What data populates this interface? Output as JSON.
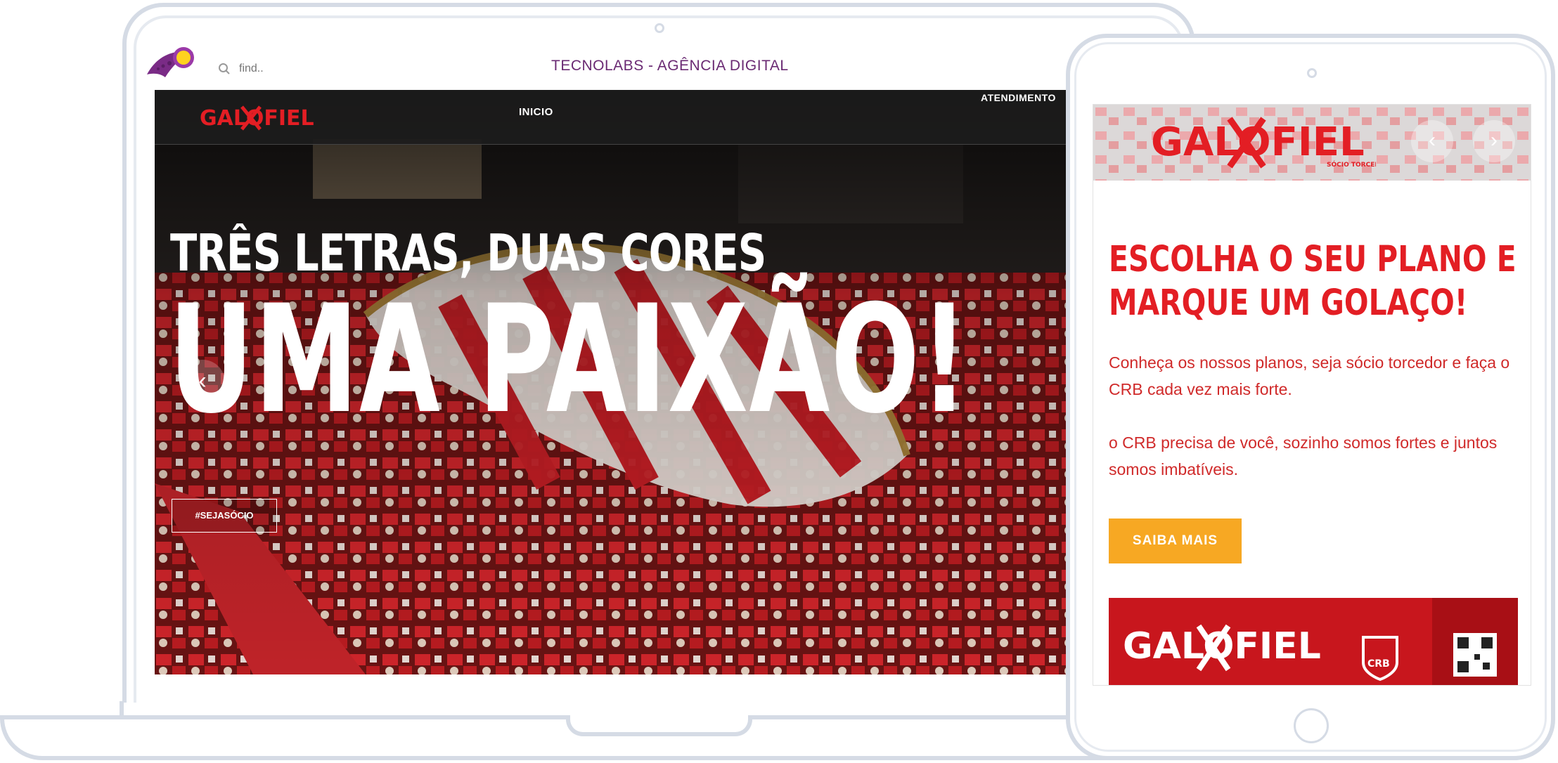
{
  "browser": {
    "search_placeholder": "find..",
    "site_title": "TECNOLABS - AGÊNCIA DIGITAL"
  },
  "hero": {
    "nav": {
      "logo_text": "GALOFIEL",
      "inicio": "INICIO",
      "atendimento": "ATENDIMENTO"
    },
    "subtitle": "TRÊS LETRAS, DUAS CORES",
    "title": "UMA PAIXÃO!",
    "cta": "#SEJASÓCIO",
    "prev_arrow": "‹"
  },
  "tablet": {
    "logo_text": "GALOFIEL",
    "logo_tagline": "SÓCIO TORCEDOR",
    "prev_arrow": "‹",
    "next_arrow": "›",
    "heading_line1": "ESCOLHA O SEU PLANO E",
    "heading_line2": "MARQUE UM GOLAÇO!",
    "paragraph1": "Conheça os nossos planos, seja sócio torcedor e faça o CRB cada vez mais forte.",
    "paragraph2": "o CRB precisa de você, sozinho somos fortes e juntos somos imbatíveis.",
    "button": "SAIBA MAIS",
    "banner_logo": "GALOFIEL",
    "banner_badge": "CRB"
  },
  "colors": {
    "brand_red": "#e31e24",
    "button_orange": "#f7a823",
    "agency_purple": "#6a2a73"
  }
}
